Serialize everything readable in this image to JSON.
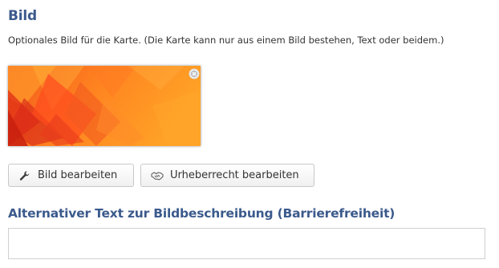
{
  "section": {
    "title": "Bild",
    "description": "Optionales Bild für die Karte. (Die Karte kann nur aus einem Bild bestehen, Text oder beidem.)"
  },
  "image": {
    "icon": "abstract-orange-image",
    "remove_icon": "remove-circle-icon"
  },
  "buttons": {
    "edit_image": {
      "label": "Bild bearbeiten",
      "icon": "wrench-icon"
    },
    "edit_copyright": {
      "label": "Urheberrecht bearbeiten",
      "icon": "handshake-icon"
    }
  },
  "alt_text": {
    "title": "Alternativer Text zur Bildbeschreibung (Barrierefreiheit)",
    "value": "",
    "placeholder": ""
  },
  "colors": {
    "heading": "#3b5a8c",
    "image_orange": "#ff8a1e",
    "image_red": "#f03a1a"
  }
}
